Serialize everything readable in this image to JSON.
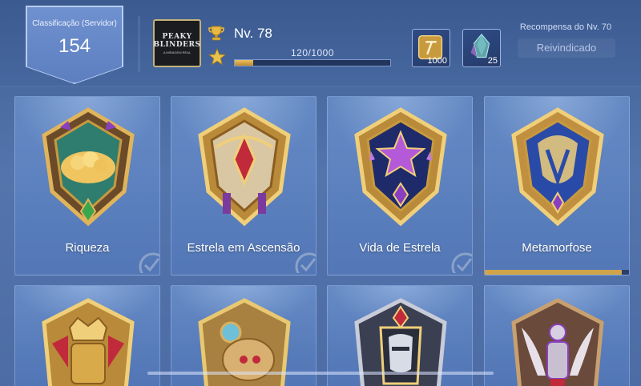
{
  "server_rank": {
    "label": "Classificação (Servidor)",
    "value": "154"
  },
  "profile": {
    "avatar_lines": [
      "PEAKY",
      "BLINDERS",
      "A MIRAGEM REAL"
    ],
    "level": "Nv. 78",
    "xp_text": "120/1000",
    "xp_progress": 0.12
  },
  "reward": {
    "title": "Recompensa do Nv. 70",
    "status": "Reivindicado",
    "items": [
      {
        "icon": "token-icon",
        "count": "1000"
      },
      {
        "icon": "crystal-icon",
        "count": "25"
      }
    ]
  },
  "cards": [
    {
      "name": "Riqueza",
      "icon": "wealth-emblem-icon",
      "checked": true
    },
    {
      "name": "Estrela em Ascensão",
      "icon": "rising-star-emblem-icon",
      "checked": true
    },
    {
      "name": "Vida de Estrela",
      "icon": "star-life-emblem-icon",
      "checked": true
    },
    {
      "name": "Metamorfose",
      "icon": "metamorphosis-emblem-icon",
      "checked": false,
      "progress": 0.95
    }
  ],
  "row2_icons": [
    "crowned-armor-emblem-icon",
    "robot-emblem-icon",
    "knight-emblem-icon",
    "winged-warrior-emblem-icon"
  ],
  "colors": {
    "gold": "#d0a44a",
    "bg": "#4d6ca5",
    "accent_purple": "#8a3fc0"
  }
}
